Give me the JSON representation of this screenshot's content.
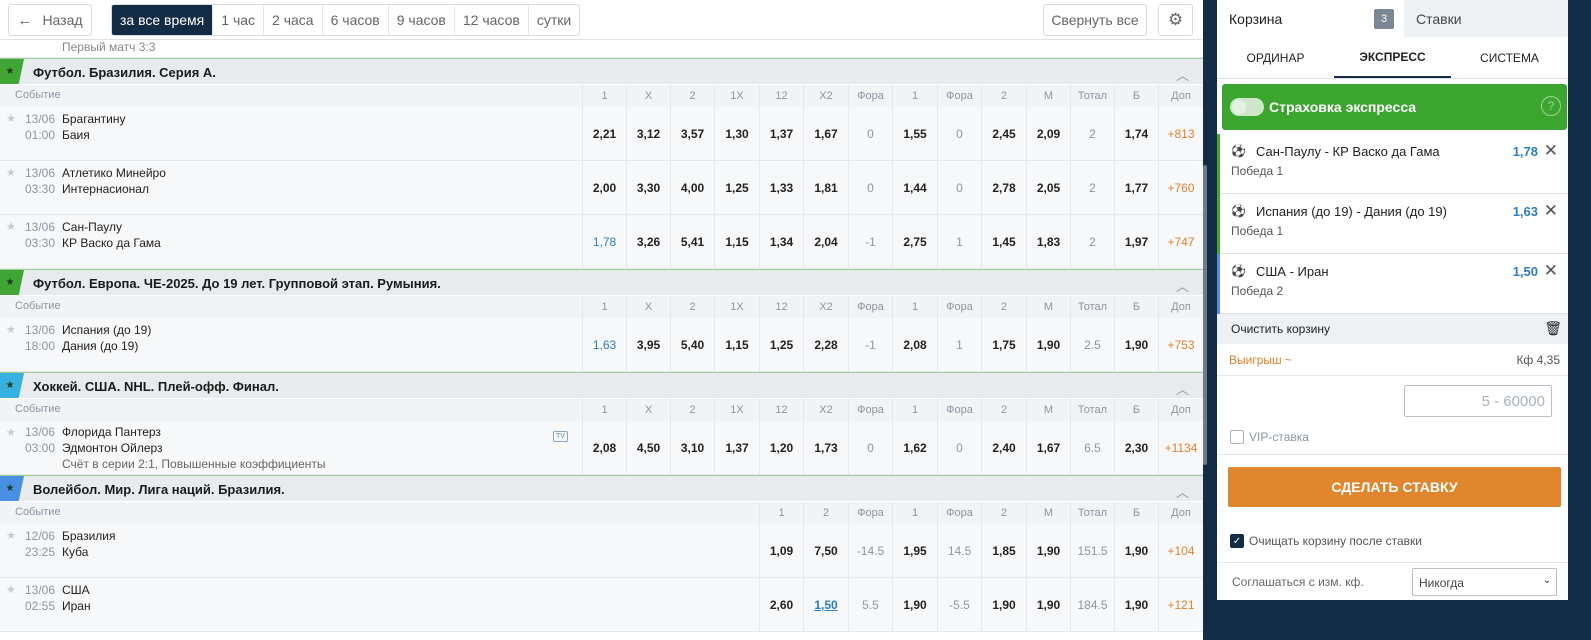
{
  "toolbar": {
    "back_label": "Назад",
    "periods": [
      "за все время",
      "1 час",
      "2 часа",
      "6 часов",
      "9 часов",
      "12 часов",
      "сутки"
    ],
    "active_period": "за все время",
    "collapse_label": "Свернуть все"
  },
  "cut_row_text": "Первый матч 3:3",
  "headers": {
    "event": "Событие",
    "full": [
      "1",
      "X",
      "2",
      "1X",
      "12",
      "X2",
      "Фора",
      "1",
      "Фора",
      "2",
      "М",
      "Тотал",
      "Б",
      "Доп"
    ],
    "volley": [
      "1",
      "2",
      "Фора",
      "1",
      "Фора",
      "2",
      "М",
      "Тотал",
      "Б",
      "Доп"
    ]
  },
  "leagues": [
    {
      "name": "Футбол. Бразилия. Серия А.",
      "color": "#3fa535"
    },
    {
      "name": "Футбол. Европа. ЧЕ-2025. До 19 лет. Групповой этап. Румыния.",
      "color": "#3fa535"
    },
    {
      "name": "Хоккей. США. NHL. Плей-офф. Финал.",
      "color": "#38b0e0"
    },
    {
      "name": "Волейбол. Мир. Лига наций. Бразилия.",
      "color": "#4a90e2"
    }
  ],
  "matches": [
    {
      "date": "13/06",
      "time": "01:00",
      "team1": "Брагантину",
      "team2": "Баия",
      "odds": [
        "2,21",
        "3,12",
        "3,57",
        "1,30",
        "1,37",
        "1,67",
        "0",
        "1,55",
        "0",
        "2,45",
        "2,09",
        "2",
        "1,74",
        "+813"
      ]
    },
    {
      "date": "13/06",
      "time": "03:30",
      "team1": "Атлетико Минейро",
      "team2": "Интернасионал",
      "odds": [
        "2,00",
        "3,30",
        "4,00",
        "1,25",
        "1,33",
        "1,81",
        "0",
        "1,44",
        "0",
        "2,78",
        "2,05",
        "2",
        "1,77",
        "+760"
      ]
    },
    {
      "date": "13/06",
      "time": "03:30",
      "team1": "Сан-Паулу",
      "team2": "КР Васко да Гама",
      "odds": [
        "1,78",
        "3,26",
        "5,41",
        "1,15",
        "1,34",
        "2,04",
        "-1",
        "2,75",
        "1",
        "1,45",
        "1,83",
        "2",
        "1,97",
        "+747"
      ]
    },
    {
      "date": "13/06",
      "time": "18:00",
      "team1": "Испания (до 19)",
      "team2": "Дания (до 19)",
      "odds": [
        "1,63",
        "3,95",
        "5,40",
        "1,15",
        "1,25",
        "2,28",
        "-1",
        "2,08",
        "1",
        "1,75",
        "1,90",
        "2.5",
        "1,90",
        "+753"
      ]
    },
    {
      "date": "13/06",
      "time": "03:00",
      "team1": "Флорида Пантерз",
      "team2": "Эдмонтон Ойлерз",
      "note": "Счёт в серии 2:1, Повышенные коэффициенты",
      "tv": "TV",
      "odds": [
        "2,08",
        "4,50",
        "3,10",
        "1,37",
        "1,20",
        "1,73",
        "0",
        "1,62",
        "0",
        "2,40",
        "1,67",
        "6.5",
        "2,30",
        "+1134"
      ]
    },
    {
      "date": "12/06",
      "time": "23:25",
      "team1": "Бразилия",
      "team2": "Куба",
      "odds": [
        "1,09",
        "7,50",
        "-14.5",
        "1,95",
        "14.5",
        "1,85",
        "1,90",
        "151.5",
        "1,90",
        "+104"
      ]
    },
    {
      "date": "13/06",
      "time": "02:55",
      "team1": "США",
      "team2": "Иран",
      "odds": [
        "2,60",
        "1,50",
        "5.5",
        "1,90",
        "-5.5",
        "1,90",
        "1,90",
        "184.5",
        "1,90",
        "+121"
      ]
    }
  ],
  "slip": {
    "tab_cart": "Корзина",
    "cart_count": "3",
    "tab_bets": "Ставки",
    "types": [
      "ОРДИНАР",
      "ЭКСПРЕСС",
      "СИСТЕМА"
    ],
    "active_type": "ЭКСПРЕСС",
    "insurance": "Страховка экспресса",
    "help": "?",
    "items": [
      {
        "match": "Сан-Паулу - КР Васко да Гама",
        "outcome": "Победа 1",
        "odd": "1,78",
        "bar": "#3fa535"
      },
      {
        "match": "Испания (до 19) - Дания (до 19)",
        "outcome": "Победа 1",
        "odd": "1,63",
        "bar": "#3fa535"
      },
      {
        "match": "США - Иран",
        "outcome": "Победа 2",
        "odd": "1,50",
        "bar": "#4a90e2"
      }
    ],
    "clear": "Очистить корзину",
    "win_label": "Выигрыш  ~",
    "coef": "Кф 4,35",
    "amount_placeholder": "5 - 60000",
    "vip": "VIP-ставка",
    "make_bet": "СДЕЛАТЬ СТАВКУ",
    "clear_after": "Очищать корзину после ставки",
    "agree_label": "Соглашаться с изм. кф.",
    "agree_value": "Никогда"
  },
  "colors": {
    "dark": "#132c45",
    "accent_orange": "#e0862e",
    "link_blue": "#2b7cc0",
    "green": "#3ca52f"
  }
}
